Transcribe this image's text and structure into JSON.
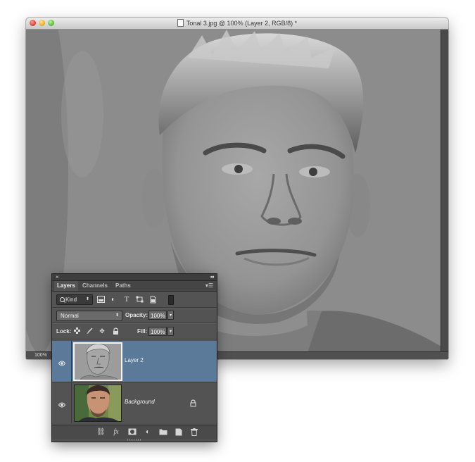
{
  "document": {
    "title": "Tonal 3.jpg @ 100% (Layer 2, RGB/8) *",
    "zoom_readout": "100%"
  },
  "layers_panel": {
    "tabs": [
      {
        "label": "Layers",
        "active": true
      },
      {
        "label": "Channels",
        "active": false
      },
      {
        "label": "Paths",
        "active": false
      }
    ],
    "filter": {
      "kind_label": "Kind",
      "icons": [
        "pixel-layer-filter-icon",
        "adjustment-layer-filter-icon",
        "type-layer-filter-icon",
        "shape-layer-filter-icon",
        "smart-object-filter-icon"
      ]
    },
    "blend_mode": "Normal",
    "opacity_label": "Opacity:",
    "opacity_value": "100%",
    "lock_label": "Lock:",
    "fill_label": "Fill:",
    "fill_value": "100%",
    "layers": [
      {
        "name": "Layer 2",
        "selected": true,
        "visible": true,
        "locked": false
      },
      {
        "name": "Background",
        "selected": false,
        "visible": true,
        "locked": true
      }
    ],
    "footer_icons": [
      "link-layers-icon",
      "layer-style-fx-icon",
      "add-mask-icon",
      "adjustment-layer-icon",
      "new-group-icon",
      "new-layer-icon",
      "delete-layer-icon"
    ]
  },
  "colors": {
    "selection": "#5b7a99",
    "panel_bg": "#535353",
    "close": "#e0443a",
    "minimize": "#e8b22b",
    "zoom": "#5fbe3f"
  }
}
